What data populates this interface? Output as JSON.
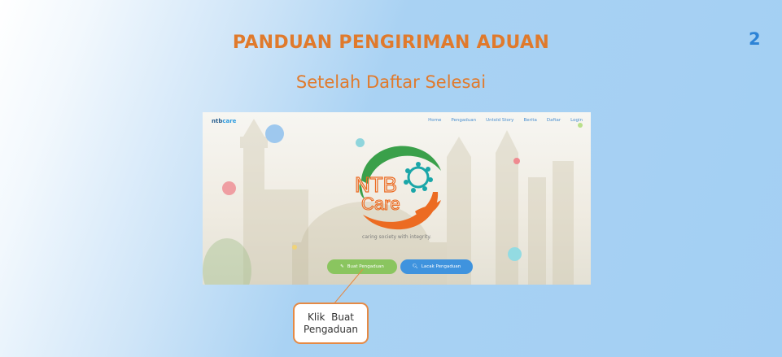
{
  "slide": {
    "page_number": "2",
    "title": "PANDUAN PENGIRIMAN ADUAN",
    "subtitle": "Setelah Daftar Selesai"
  },
  "screenshot": {
    "brand": {
      "part1": "ntb",
      "part2": "care"
    },
    "nav_items": [
      "Home",
      "Pengaduan",
      "Untold Story",
      "Berita",
      "Daftar",
      "Login"
    ],
    "logo": {
      "text_top": "NTB",
      "text_bottom": "Care"
    },
    "tagline": "caring society with integrity.",
    "buttons": {
      "buat_label": "Buat Pengaduan",
      "lacak_label": "Lacak Pengaduan"
    }
  },
  "callout": {
    "line1": "Klik  Buat",
    "line2": "Pengaduan"
  },
  "colors": {
    "title": "#e07a2c",
    "page_number": "#2d83d6",
    "buat_button": "#8ac55f",
    "lacak_button": "#3f93de",
    "callout_border": "#e58a45"
  }
}
